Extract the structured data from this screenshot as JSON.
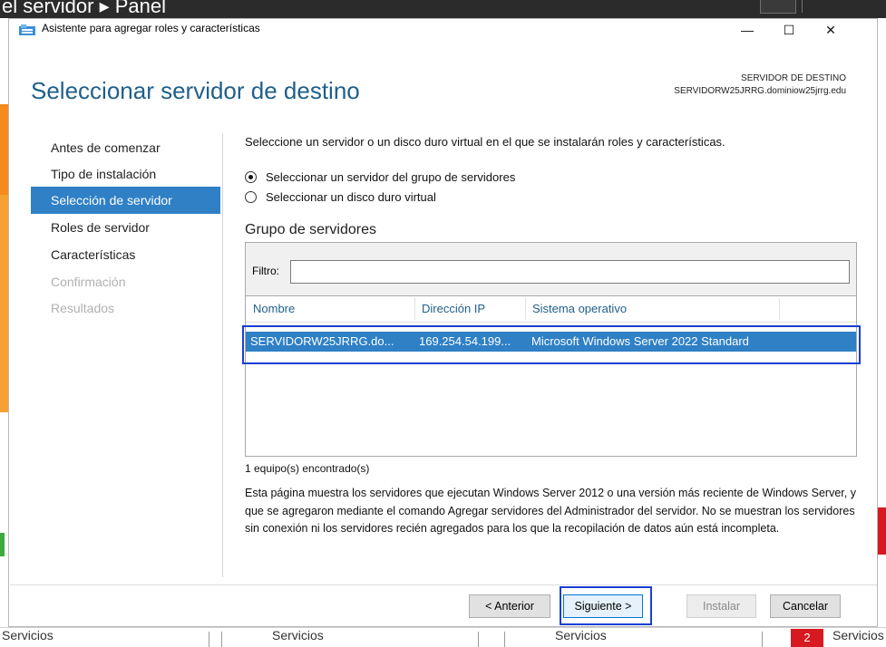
{
  "background": {
    "title": "el servidor ▸ Panel",
    "services": [
      "Servicios",
      "Servicios",
      "Servicios",
      "Servicios"
    ],
    "badge": "2"
  },
  "window": {
    "title": "Asistente para agregar roles y características",
    "min_glyph": "—",
    "max_glyph": "☐",
    "close_glyph": "✕"
  },
  "header": {
    "page_title": "Seleccionar servidor de destino",
    "dest_label": "SERVIDOR DE DESTINO",
    "dest_value": "SERVIDORW25JRRG.dominiow25jrrg.edu"
  },
  "nav": {
    "items": [
      {
        "label": "Antes de comenzar",
        "state": "normal"
      },
      {
        "label": "Tipo de instalación",
        "state": "normal"
      },
      {
        "label": "Selección de servidor",
        "state": "active"
      },
      {
        "label": "Roles de servidor",
        "state": "normal"
      },
      {
        "label": "Características",
        "state": "normal"
      },
      {
        "label": "Confirmación",
        "state": "disabled"
      },
      {
        "label": "Resultados",
        "state": "disabled"
      }
    ]
  },
  "content": {
    "intro": "Seleccione un servidor o un disco duro virtual en el que se instalarán roles y características.",
    "radio_pool": "Seleccionar un servidor del grupo de servidores",
    "radio_vhd": "Seleccionar un disco duro virtual",
    "group_title": "Grupo de servidores",
    "filter_label": "Filtro:",
    "filter_value": "",
    "columns": [
      "Nombre",
      "Dirección IP",
      "Sistema operativo"
    ],
    "rows": [
      {
        "name": "SERVIDORW25JRRG.do...",
        "ip": "169.254.54.199...",
        "os": "Microsoft Windows Server 2022 Standard"
      }
    ],
    "count": "1 equipo(s) encontrado(s)",
    "info": "Esta página muestra los servidores que ejecutan Windows Server 2012 o una versión más reciente de Windows Server, y que se agregaron mediante el comando Agregar servidores del Administrador del servidor. No se muestran los servidores sin conexión ni los servidores recién agregados para los que la recopilación de datos aún está incompleta."
  },
  "footer": {
    "prev": "< Anterior",
    "next": "Siguiente >",
    "install": "Instalar",
    "cancel": "Cancelar"
  },
  "colors": {
    "accent": "#2f80c5",
    "title": "#1f5f8b",
    "highlight_box": "#1a3fd1"
  }
}
